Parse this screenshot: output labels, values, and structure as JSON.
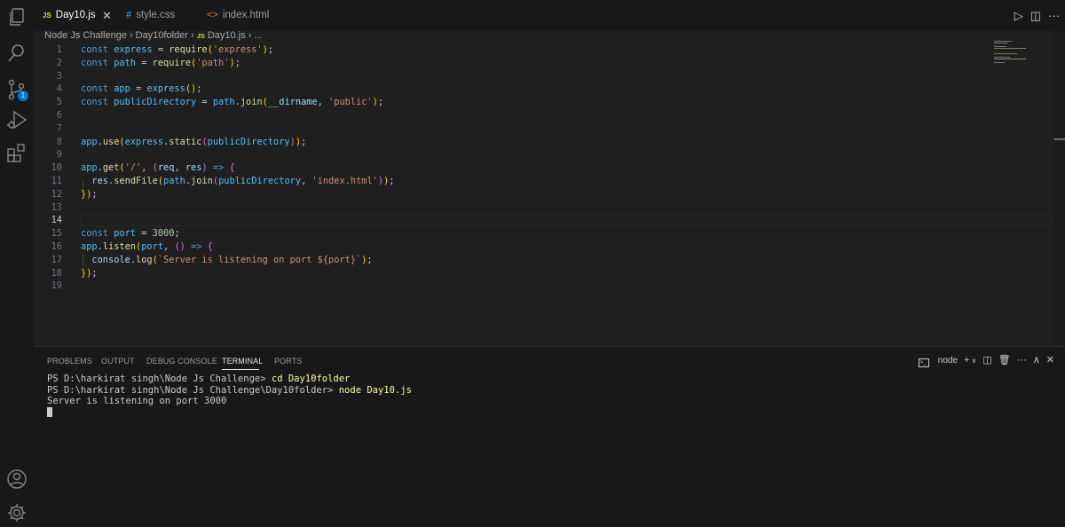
{
  "tabs": [
    {
      "label": "Day10.js",
      "icon_text": "JS",
      "active": true
    },
    {
      "label": "style.css",
      "icon_text": "#",
      "active": false
    },
    {
      "label": "index.html",
      "icon_text": "<>",
      "active": false
    }
  ],
  "tab_close_glyph": "✕",
  "breadcrumb": {
    "items": [
      "Node Js Challenge",
      "Day10folder",
      "Day10.js",
      "..."
    ],
    "file_icon_text": "JS"
  },
  "editor": {
    "current_line": 14,
    "lines": [
      {
        "n": "1",
        "text": "const express = require('express');"
      },
      {
        "n": "2",
        "text": "const path = require('path');"
      },
      {
        "n": "3",
        "text": ""
      },
      {
        "n": "4",
        "text": "const app = express();"
      },
      {
        "n": "5",
        "text": "const publicDirectory = path.join(__dirname, 'public');"
      },
      {
        "n": "6",
        "text": ""
      },
      {
        "n": "7",
        "text": ""
      },
      {
        "n": "8",
        "text": "app.use(express.static(publicDirectory));"
      },
      {
        "n": "9",
        "text": ""
      },
      {
        "n": "10",
        "text": "app.get('/', (req, res) => {"
      },
      {
        "n": "11",
        "text": "  res.sendFile(path.join(publicDirectory, 'index.html'));"
      },
      {
        "n": "12",
        "text": "});"
      },
      {
        "n": "13",
        "text": ""
      },
      {
        "n": "14",
        "text": ""
      },
      {
        "n": "15",
        "text": "const port = 3000;"
      },
      {
        "n": "16",
        "text": "app.listen(port, () => {"
      },
      {
        "n": "17",
        "text": "  console.log(`Server is listening on port ${port}`);"
      },
      {
        "n": "18",
        "text": "});"
      },
      {
        "n": "19",
        "text": ""
      }
    ]
  },
  "panel": {
    "tabs": [
      "PROBLEMS",
      "OUTPUT",
      "DEBUG CONSOLE",
      "TERMINAL",
      "PORTS"
    ],
    "active_tab": "TERMINAL",
    "terminal_name": "node",
    "terminal_lines": [
      {
        "prompt": "PS D:\\harkirat singh\\Node Js Challenge> ",
        "cmd": "cd Day10folder"
      },
      {
        "prompt": "PS D:\\harkirat singh\\Node Js Challenge\\Day10folder> ",
        "cmd": "node Day10.js"
      },
      {
        "prompt": "Server is listening on port 3000",
        "cmd": ""
      }
    ]
  },
  "activity_badge": "1",
  "colors": {
    "background": "#1f1f1f",
    "sidebar": "#181818",
    "keyword": "#569cd6",
    "string": "#ce9178",
    "function": "#dcdcaa",
    "accent": "#0078d4"
  }
}
